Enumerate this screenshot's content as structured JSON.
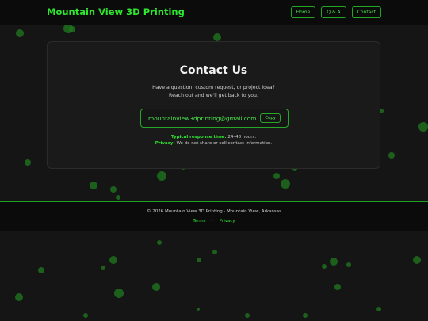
{
  "header": {
    "brand": "Mountain View 3D Printing",
    "nav": [
      "Home",
      "Q & A",
      "Contact"
    ]
  },
  "contact": {
    "title": "Contact Us",
    "desc_line1": "Have a question, custom request, or project idea?",
    "desc_line2": "Reach out and we'll get back to you.",
    "email": "mountainview3dprinting@gmail.com",
    "copy_label": "Copy",
    "response_label": "Typical response time:",
    "response_value": "24–48 hours.",
    "privacy_label": "Privacy:",
    "privacy_value": "We do not share or sell contact information."
  },
  "footer": {
    "copyright": "© 2026 Mountain View 3D Printing · Mountain View, Arkansas",
    "links": [
      "Terms",
      "Privacy"
    ],
    "separator": "·"
  },
  "colors": {
    "accent": "#2ee62e",
    "background": "#151515",
    "card": "#1a1a1a",
    "dot": "#1f7a1f"
  }
}
